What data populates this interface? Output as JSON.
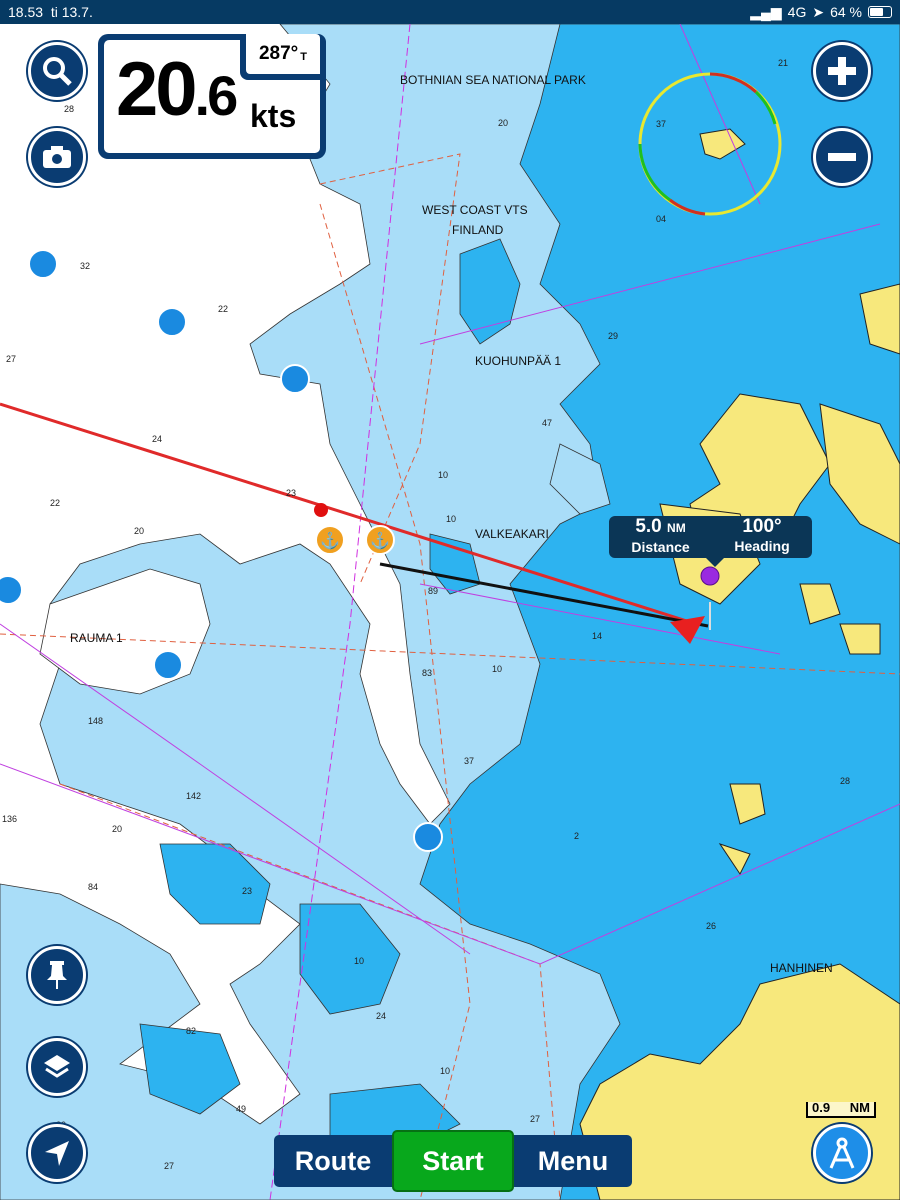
{
  "status_bar": {
    "time": "18.53",
    "date": "ti 13.7.",
    "network": "4G",
    "battery": "64 %",
    "battery_level": 0.64
  },
  "speed_panel": {
    "speed_int": "20",
    "speed_dec": ".6",
    "unit": "kts",
    "heading": "287°",
    "heading_ref": "T"
  },
  "route_tooltip": {
    "distance": "5.0",
    "distance_unit": "NM",
    "distance_label": "Distance",
    "heading": "100°",
    "heading_label": "Heading"
  },
  "bottom_bar": {
    "route": "Route",
    "start": "Start",
    "menu": "Menu"
  },
  "scale": {
    "value": "0.9",
    "unit": "NM"
  },
  "buttons": {
    "search": "search-icon",
    "camera": "camera-icon",
    "zoom_in": "plus-icon",
    "zoom_out": "minus-icon",
    "pin": "pin-icon",
    "layers": "layers-icon",
    "locate": "navigation-arrow-icon",
    "measure": "compass-icon"
  },
  "map_labels": {
    "park": "BOTHNIAN SEA NATIONAL PARK",
    "vts1": "WEST COAST VTS",
    "vts2": "FINLAND",
    "kuohunpaa": "KUOHUNPÄÄ 1",
    "valkeakari": "VALKEAKARI",
    "rauma": "RAUMA 1",
    "hanhinen": "HANHINEN"
  },
  "depths": [
    "28",
    "20",
    "32",
    "22",
    "27",
    "24",
    "22",
    "23",
    "20",
    "10",
    "47",
    "29",
    "37",
    "04",
    "21",
    "10",
    "89",
    "14",
    "83",
    "10",
    "148",
    "142",
    "136",
    "20",
    "37",
    "23",
    "84",
    "10",
    "82",
    "24",
    "10",
    "27",
    "49",
    "20",
    "27",
    "2",
    "26",
    "28"
  ],
  "colors": {
    "deep": "#ffffff",
    "shallow": "#a9ddf8",
    "medium": "#2db3f0",
    "land": "#f7e87c",
    "navy": "#0a3c72",
    "start": "#08a81c",
    "route_line": "#e02a2a"
  }
}
